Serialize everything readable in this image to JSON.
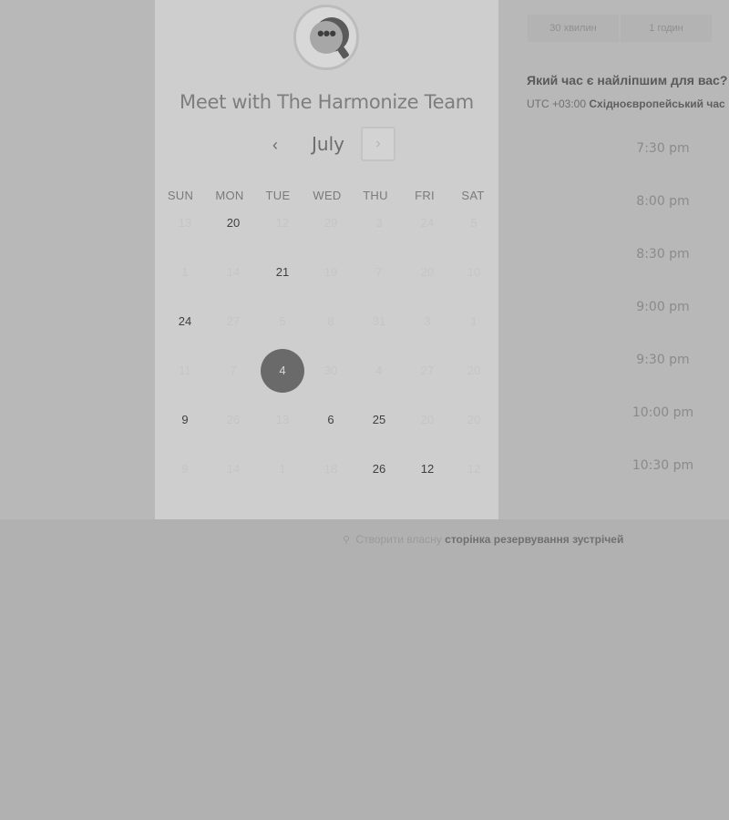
{
  "colors": {
    "page_background": "#b1b1b1",
    "calendar_panel": "#cecece",
    "selected_day": "#6a6a6a"
  },
  "meeting": {
    "title": "Meet with The Harmonize Team",
    "avatar_icon": "chat-bubble-icon",
    "avatar_glyph": "•••"
  },
  "calendar": {
    "month": "July",
    "prev_glyph": "‹",
    "next_glyph": "›",
    "weekdays": [
      "SUN",
      "MON",
      "TUE",
      "WED",
      "THU",
      "FRI",
      "SAT"
    ],
    "weeks": [
      [
        {
          "d": "13",
          "s": "disabled"
        },
        {
          "d": "20",
          "s": "available"
        },
        {
          "d": "12",
          "s": "disabled"
        },
        {
          "d": "29",
          "s": "disabled"
        },
        {
          "d": "3",
          "s": "disabled"
        },
        {
          "d": "24",
          "s": "disabled"
        },
        {
          "d": "5",
          "s": "disabled"
        }
      ],
      [
        {
          "d": "1",
          "s": "disabled"
        },
        {
          "d": "14",
          "s": "disabled"
        },
        {
          "d": "21",
          "s": "available"
        },
        {
          "d": "19",
          "s": "disabled"
        },
        {
          "d": "7",
          "s": "disabled"
        },
        {
          "d": "20",
          "s": "disabled"
        },
        {
          "d": "10",
          "s": "disabled"
        }
      ],
      [
        {
          "d": "24",
          "s": "available"
        },
        {
          "d": "27",
          "s": "disabled"
        },
        {
          "d": "5",
          "s": "disabled"
        },
        {
          "d": "8",
          "s": "disabled"
        },
        {
          "d": "31",
          "s": "disabled"
        },
        {
          "d": "3",
          "s": "disabled"
        },
        {
          "d": "1",
          "s": "disabled"
        }
      ],
      [
        {
          "d": "11",
          "s": "disabled"
        },
        {
          "d": "7",
          "s": "disabled"
        },
        {
          "d": "4",
          "s": "selected"
        },
        {
          "d": "30",
          "s": "disabled"
        },
        {
          "d": "4",
          "s": "disabled"
        },
        {
          "d": "27",
          "s": "disabled"
        },
        {
          "d": "20",
          "s": "disabled"
        }
      ],
      [
        {
          "d": "9",
          "s": "available"
        },
        {
          "d": "26",
          "s": "disabled"
        },
        {
          "d": "13",
          "s": "disabled"
        },
        {
          "d": "6",
          "s": "available"
        },
        {
          "d": "25",
          "s": "available"
        },
        {
          "d": "20",
          "s": "disabled"
        },
        {
          "d": "20",
          "s": "disabled"
        }
      ],
      [
        {
          "d": "9",
          "s": "disabled"
        },
        {
          "d": "14",
          "s": "disabled"
        },
        {
          "d": "1",
          "s": "disabled"
        },
        {
          "d": "18",
          "s": "disabled"
        },
        {
          "d": "26",
          "s": "available"
        },
        {
          "d": "12",
          "s": "available"
        },
        {
          "d": "12",
          "s": "disabled"
        }
      ]
    ]
  },
  "durations": [
    "30 хвилин",
    "1 годин"
  ],
  "scheduling": {
    "question": "Який час є найліпшим для вас?",
    "timezone_offset": "UTC +03:00",
    "timezone_name": "Східноєвропейський час"
  },
  "time_slots": [
    "7:30 pm",
    "8:00 pm",
    "8:30 pm",
    "9:00 pm",
    "9:30 pm",
    "10:00 pm",
    "10:30 pm"
  ],
  "footer": {
    "icon": "link-icon",
    "glyph": "⚲",
    "prefix": "Створити власну",
    "link_text": "сторінка резервування зустрічей"
  }
}
